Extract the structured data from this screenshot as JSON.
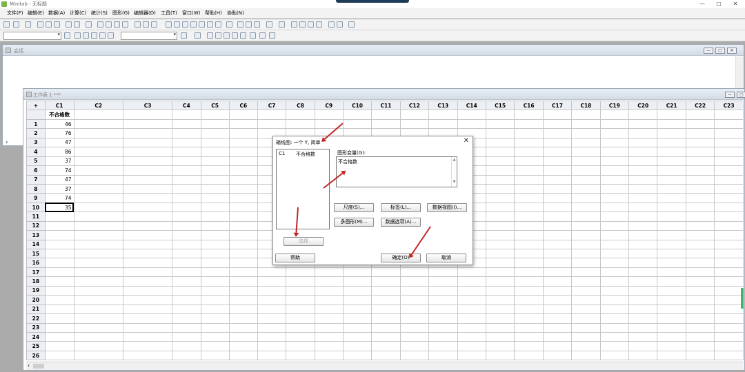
{
  "app": {
    "title": "Minitab - 无标题"
  },
  "window_controls": {
    "minimize": "—",
    "maximize": "▢",
    "close": "✕"
  },
  "menu": [
    "文件(F)",
    "编辑(E)",
    "数据(A)",
    "计算(C)",
    "统计(S)",
    "图形(G)",
    "编辑器(D)",
    "工具(T)",
    "窗口(W)",
    "帮助(H)",
    "协助(N)"
  ],
  "session": {
    "title": "会话",
    "scroll_left": "‹"
  },
  "worksheet": {
    "title": "工作表 1 ***",
    "corner": "+",
    "columns": [
      "C1",
      "C2",
      "C3",
      "C4",
      "C5",
      "C6",
      "C7",
      "C8",
      "C9",
      "C10",
      "C11",
      "C12",
      "C13",
      "C14",
      "C15",
      "C16",
      "C17",
      "C18",
      "C19",
      "C20",
      "C21",
      "C22",
      "C23"
    ],
    "column_names": [
      "不合格数"
    ],
    "rows": [
      "1",
      "2",
      "3",
      "4",
      "5",
      "6",
      "7",
      "8",
      "9",
      "10",
      "11",
      "12",
      "13",
      "14",
      "15",
      "16",
      "17",
      "18",
      "19",
      "20",
      "21",
      "22",
      "23",
      "24",
      "25",
      "26"
    ],
    "c1_values": [
      "46",
      "76",
      "47",
      "86",
      "37",
      "74",
      "47",
      "37",
      "74",
      "35"
    ],
    "scroll_left": "‹"
  },
  "dialog": {
    "title": "箱线图: 一个 Y, 简单",
    "close": "✕",
    "var_list": {
      "column": "C1",
      "name": "不合格数"
    },
    "graph_vars_label": "图形变量(G):",
    "graph_vars_value": "不合格数",
    "buttons": {
      "scale": "尺度(S)...",
      "labels": "标签(L)...",
      "data_view": "数据视图(I)...",
      "multiple_graphs": "多图形(M)...",
      "data_options": "数据选项(A)...",
      "select": "选择",
      "help": "帮助",
      "ok": "确定(O)",
      "cancel": "取消"
    }
  },
  "colors": {
    "arrow": "#c42525",
    "accent": "#3eb36c",
    "chrome": "#d3dbe6"
  }
}
